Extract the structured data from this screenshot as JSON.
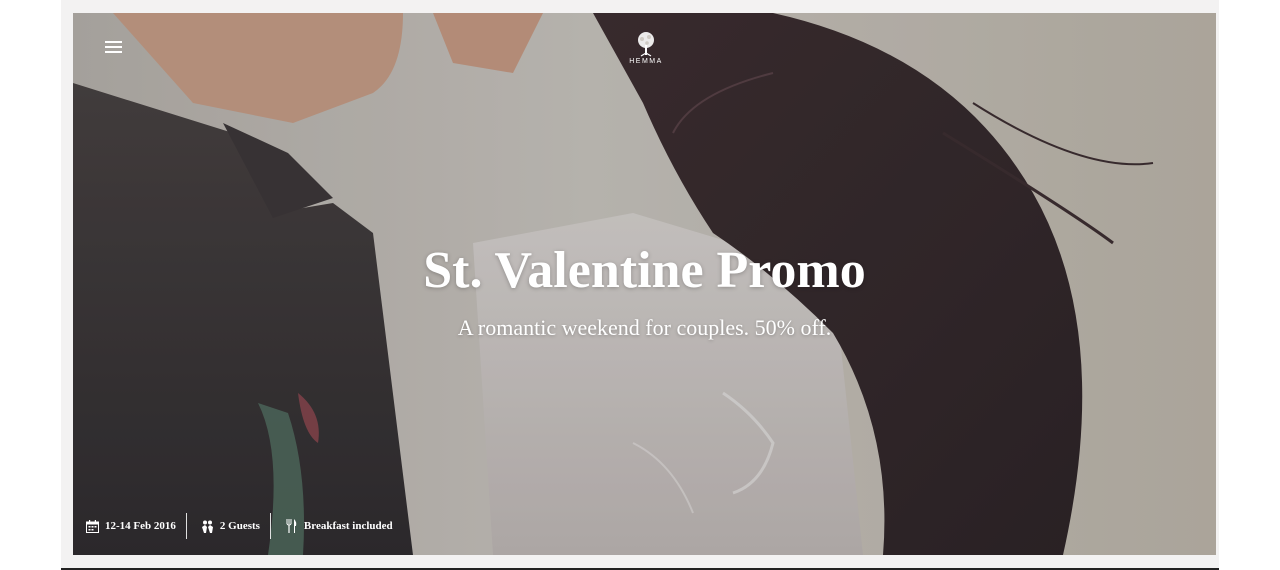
{
  "brand": {
    "name": "HEMMA",
    "logo_icon": "tree-icon"
  },
  "nav": {
    "menu_icon": "hamburger-menu-icon"
  },
  "hero": {
    "title": "St. Valentine Promo",
    "subtitle": "A romantic weekend for couples. 50% off."
  },
  "meta": [
    {
      "icon": "calendar-icon",
      "label": "12-14 Feb 2016"
    },
    {
      "icon": "guests-icon",
      "label": "2 Guests"
    },
    {
      "icon": "breakfast-icon",
      "label": "Breakfast included"
    }
  ],
  "colors": {
    "text": "#ffffff",
    "frame": "#f3f2f2"
  }
}
